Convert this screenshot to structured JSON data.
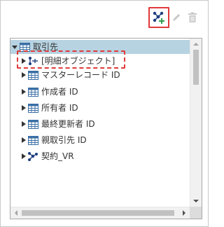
{
  "toolbar": {
    "add_icon": "add-relationship-icon",
    "edit_icon": "pencil-icon",
    "delete_icon": "trash-icon",
    "add_highlight_color": "#e03a3a"
  },
  "tree": {
    "root": {
      "label": "取引先",
      "icon": "table-icon",
      "expanded": true,
      "selected": true
    },
    "children": [
      {
        "label": "[明細オブジェクト]",
        "icon": "detail-relationship-icon",
        "highlighted": true
      },
      {
        "label": "マスターレコード ID",
        "icon": "table-icon"
      },
      {
        "label": "作成者 ID",
        "icon": "table-icon"
      },
      {
        "label": "所有者 ID",
        "icon": "table-icon"
      },
      {
        "label": "最終更新者 ID",
        "icon": "table-icon"
      },
      {
        "label": "親取引先 ID",
        "icon": "table-icon"
      },
      {
        "label": "契約_VR",
        "icon": "relationship-icon"
      }
    ]
  },
  "colors": {
    "selection": "#b7d3e2",
    "table_icon": "#3b6fa5",
    "relationship_icon": "#1f3f80"
  }
}
